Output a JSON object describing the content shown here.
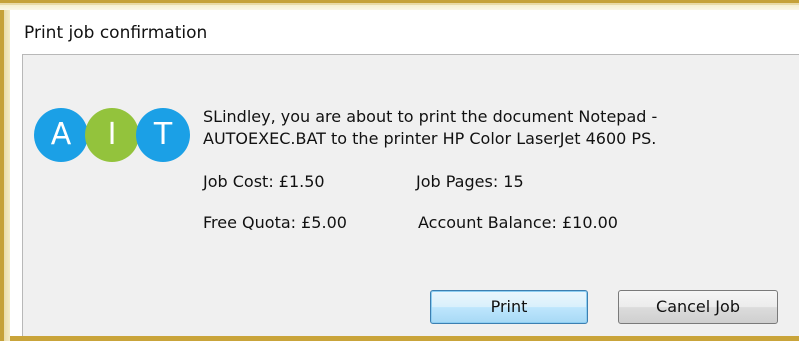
{
  "window": {
    "title": "Print job confirmation"
  },
  "logo": {
    "letters": [
      "A",
      "I",
      "T"
    ],
    "colors": [
      "#1ba0e6",
      "#93c33c",
      "#1ba0e6"
    ]
  },
  "message": {
    "line1": "SLindley, you are about to print the document Notepad -",
    "line2": "AUTOEXEC.BAT to the printer HP Color LaserJet 4600 PS."
  },
  "details": {
    "job_cost": "Job Cost: £1.50",
    "job_pages": "Job Pages: 15",
    "free_quota": "Free Quota: £5.00",
    "account_balance": "Account Balance: £10.00"
  },
  "buttons": {
    "print_label": "Print",
    "cancel_label": "Cancel Job"
  },
  "colors": {
    "frame_accent": "#c9a43a",
    "default_button_border": "#3c7fb1"
  }
}
